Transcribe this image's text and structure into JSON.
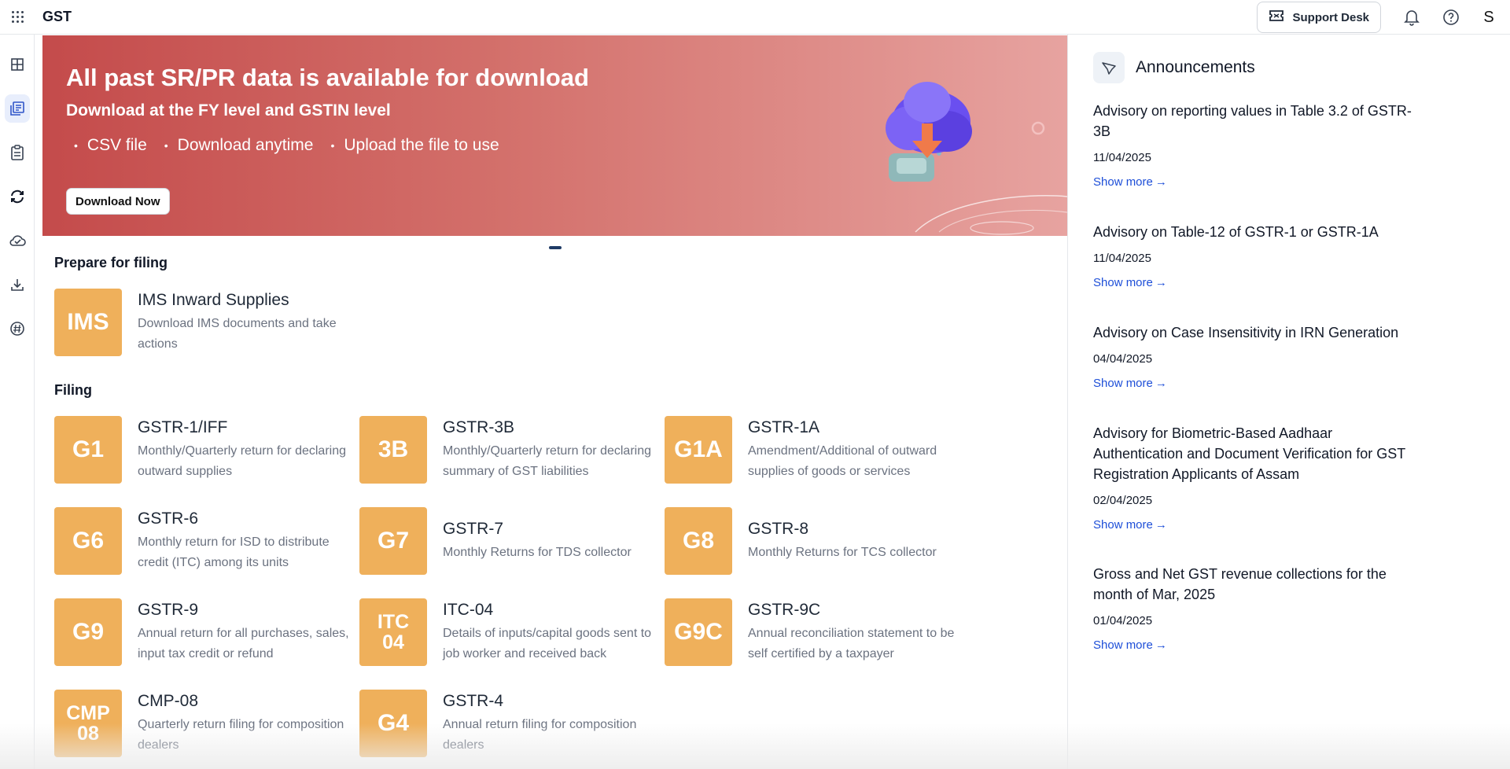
{
  "app": {
    "title": "GST"
  },
  "topbar": {
    "support_label": "Support Desk",
    "avatar_initial": "S"
  },
  "banner": {
    "title": "All past SR/PR data is available for download",
    "subtitle": "Download at the FY level and GSTIN level",
    "bullets": [
      "CSV file",
      "Download anytime",
      "Upload the file to use"
    ],
    "button_label": "Download Now"
  },
  "prepare": {
    "heading": "Prepare for filing",
    "items": [
      {
        "tile": "IMS",
        "title": "IMS Inward Supplies",
        "desc": "Download IMS documents and take actions"
      }
    ]
  },
  "filing": {
    "heading": "Filing",
    "items": [
      {
        "tile": "G1",
        "title": "GSTR-1/IFF",
        "desc": "Monthly/Quarterly return for declaring outward supplies"
      },
      {
        "tile": "3B",
        "title": "GSTR-3B",
        "desc": "Monthly/Quarterly return for declaring summary of GST liabilities"
      },
      {
        "tile": "G1A",
        "title": "GSTR-1A",
        "desc": "Amendment/Additional of outward supplies of goods or services"
      },
      {
        "tile": "G6",
        "title": "GSTR-6",
        "desc": "Monthly return for ISD to distribute credit (ITC) among its units"
      },
      {
        "tile": "G7",
        "title": "GSTR-7",
        "desc": "Monthly Returns for TDS collector"
      },
      {
        "tile": "G8",
        "title": "GSTR-8",
        "desc": "Monthly Returns for TCS collector"
      },
      {
        "tile": "G9",
        "title": "GSTR-9",
        "desc": "Annual return for all purchases, sales, input tax credit or refund"
      },
      {
        "tile": "ITC 04",
        "title": "ITC-04",
        "desc": "Details of inputs/capital goods sent to job worker and received back"
      },
      {
        "tile": "G9C",
        "title": "GSTR-9C",
        "desc": "Annual reconciliation statement to be self certified by a taxpayer"
      },
      {
        "tile": "CMP 08",
        "title": "CMP-08",
        "desc": "Quarterly return filing for composition dealers"
      },
      {
        "tile": "G4",
        "title": "GSTR-4",
        "desc": "Annual return filing for composition dealers"
      }
    ]
  },
  "announcements": {
    "heading": "Announcements",
    "show_more_label": "Show more",
    "items": [
      {
        "title": "Advisory on reporting values in Table 3.2 of GSTR-3B",
        "date": "11/04/2025"
      },
      {
        "title": "Advisory on Table-12 of GSTR-1 or GSTR-1A",
        "date": "11/04/2025"
      },
      {
        "title": "Advisory on Case Insensitivity in IRN Generation",
        "date": "04/04/2025"
      },
      {
        "title": "Advisory for Biometric-Based Aadhaar Authentication and Document Verification for GST Registration Applicants of Assam",
        "date": "02/04/2025"
      },
      {
        "title": "Gross and Net GST revenue collections for the month of Mar, 2025",
        "date": "01/04/2025"
      }
    ]
  },
  "colors": {
    "tile": "#efb05b",
    "link": "#1d4ed8",
    "banner_start": "#c44b4b",
    "banner_end": "#e7a3a0"
  },
  "icons": {
    "rail": [
      "dashboard-icon",
      "returns-icon",
      "clipboard-icon",
      "sync-icon",
      "cloud-check-icon",
      "download-icon",
      "hashtag-icon"
    ],
    "topbar": [
      "apps-grid-icon",
      "ticket-icon",
      "bell-icon",
      "help-icon"
    ]
  }
}
